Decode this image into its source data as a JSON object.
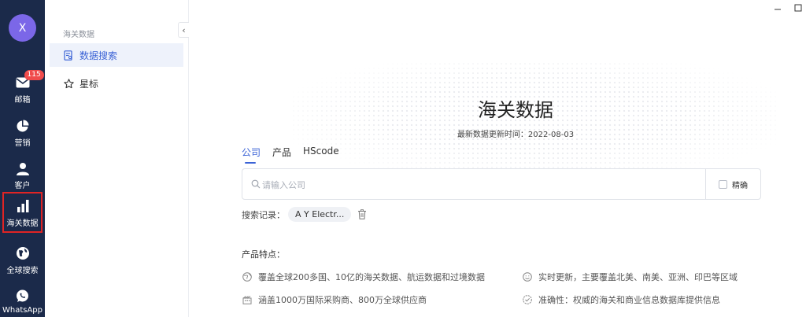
{
  "rail": {
    "avatar": "X",
    "items": [
      {
        "label": "邮箱",
        "badge": "115"
      },
      {
        "label": "营销"
      },
      {
        "label": "客户"
      },
      {
        "label": "海关数据"
      },
      {
        "label": "全球搜索"
      },
      {
        "label": "WhatsApp"
      }
    ],
    "active": "海关数据"
  },
  "subnav": {
    "title": "海关数据",
    "items": [
      {
        "label": "数据搜索",
        "active": true
      },
      {
        "label": "星标",
        "active": false
      }
    ]
  },
  "main": {
    "title": "海关数据",
    "update_text": "最新数据更新时间：2022-08-03",
    "tabs": [
      {
        "label": "公司",
        "active": true
      },
      {
        "label": "产品",
        "active": false
      },
      {
        "label": "HScode",
        "active": false
      }
    ],
    "search": {
      "placeholder": "请输入公司",
      "value": "",
      "exact_label": "精确",
      "exact_checked": false
    },
    "history": {
      "label": "搜索记录：",
      "chips": [
        "A Y Electr..."
      ]
    },
    "features": {
      "title": "产品特点：",
      "items": [
        "覆盖全球200多国、10亿的海关数据、航运数据和过境数据",
        "实时更新，主要覆盖北美、南美、亚洲、印巴等区域",
        "涵盖1000万国际采购商、800万全球供应商",
        "准确性：权威的海关和商业信息数据库提供信息"
      ]
    }
  },
  "colors": {
    "rail_bg": "#1b2a4a",
    "accent": "#3b63d6",
    "badge": "#f04b4b",
    "active_outline": "#e02424"
  }
}
